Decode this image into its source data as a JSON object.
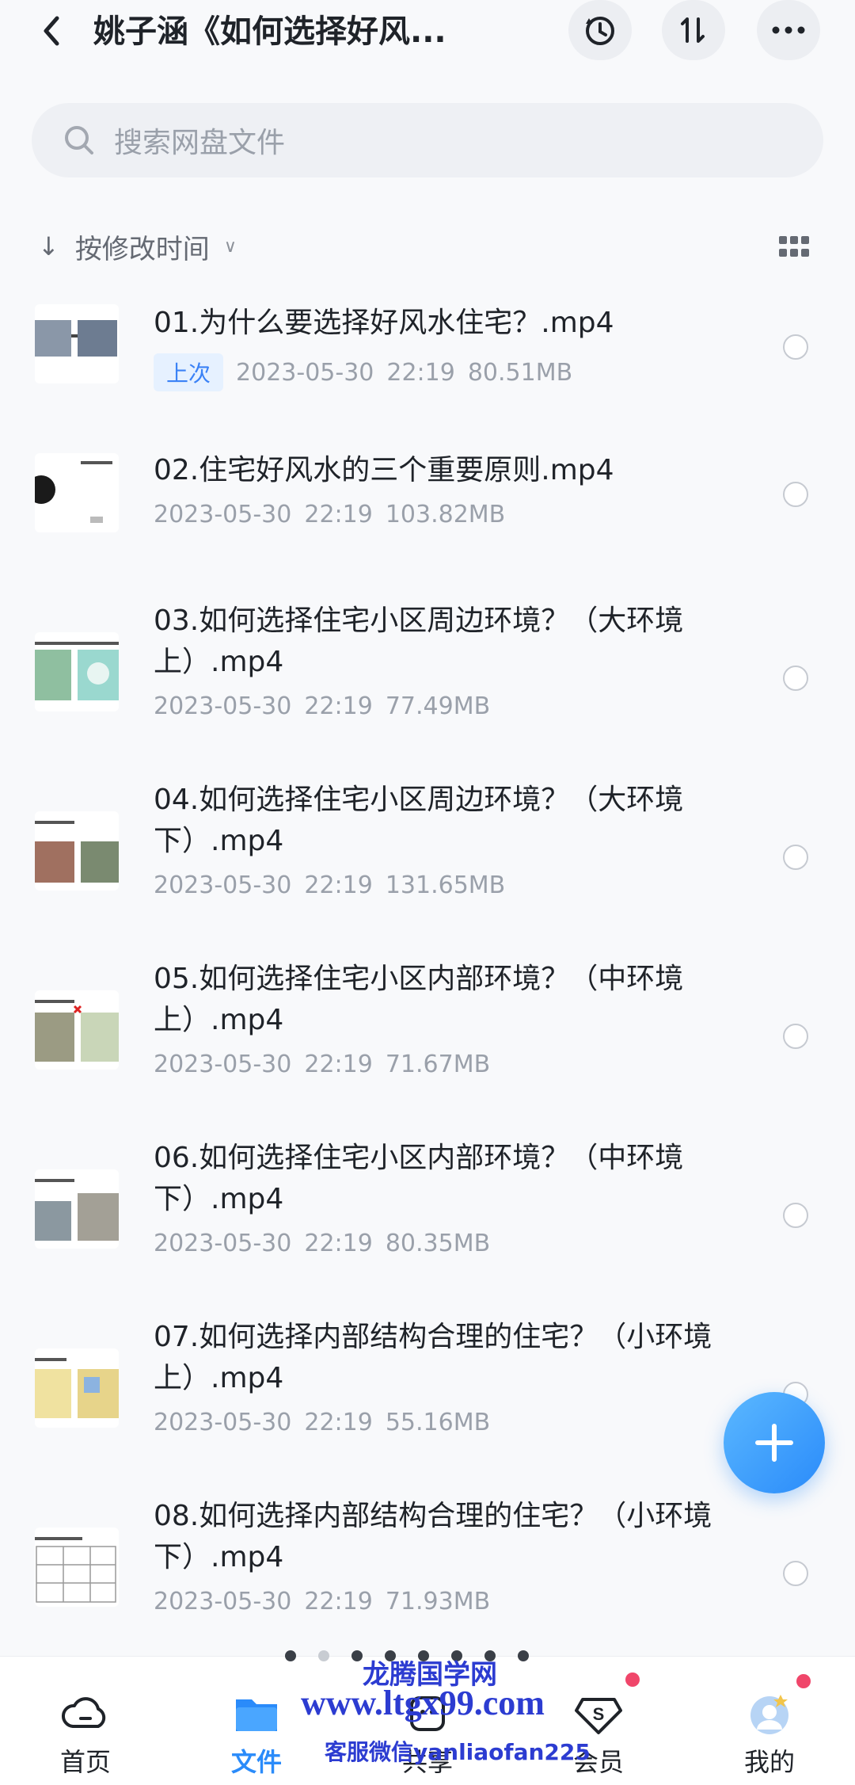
{
  "header": {
    "title": "姚子涵《如何选择好风...",
    "back_icon": "chevron-left-icon",
    "history_icon": "history-icon",
    "sort_icon": "sort-arrows-icon",
    "more_icon": "more-horizontal-icon"
  },
  "search": {
    "placeholder": "搜索网盘文件"
  },
  "sort": {
    "label": "按修改时间",
    "direction_glyph": "↓",
    "dropdown_glyph": "∨"
  },
  "files": [
    {
      "name": "01.为什么要选择好风水住宅？.mp4",
      "badge": "上次",
      "date": "2023-05-30",
      "time": "22:19",
      "size": "80.51MB"
    },
    {
      "name": "02.住宅好风水的三个重要原则.mp4",
      "date": "2023-05-30",
      "time": "22:19",
      "size": "103.82MB"
    },
    {
      "name": "03.如何选择住宅小区周边环境？（大环境上）.mp4",
      "date": "2023-05-30",
      "time": "22:19",
      "size": "77.49MB"
    },
    {
      "name": "04.如何选择住宅小区周边环境？（大环境下）.mp4",
      "date": "2023-05-30",
      "time": "22:19",
      "size": "131.65MB"
    },
    {
      "name": "05.如何选择住宅小区内部环境？（中环境上）.mp4",
      "date": "2023-05-30",
      "time": "22:19",
      "size": "71.67MB"
    },
    {
      "name": "06.如何选择住宅小区内部环境？（中环境下）.mp4",
      "date": "2023-05-30",
      "time": "22:19",
      "size": "80.35MB"
    },
    {
      "name": "07.如何选择内部结构合理的住宅？（小环境 上）.mp4",
      "date": "2023-05-30",
      "time": "22:19",
      "size": "55.16MB"
    },
    {
      "name": "08.如何选择内部结构合理的住宅？（小环境 下）.mp4",
      "date": "2023-05-30",
      "time": "22:19",
      "size": "71.93MB"
    }
  ],
  "fab": {
    "icon": "plus-icon"
  },
  "nav": {
    "home": "首页",
    "files": "文件",
    "share": "共享",
    "vip": "会员",
    "me": "我的"
  },
  "watermark": {
    "line1": "龙腾国学网",
    "line2": "www.ltgx99.com",
    "line3": "客服微信yanliaofan225"
  },
  "colors": {
    "accent": "#2a8bfa",
    "badge_bg": "#e6f1ff",
    "red_dot": "#f0466a"
  }
}
